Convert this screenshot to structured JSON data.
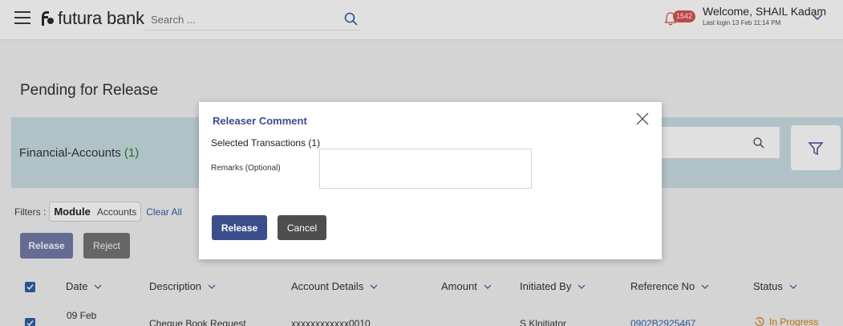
{
  "header": {
    "bank_name": "futura bank",
    "search_placeholder": "Search ...",
    "notification_count": "1542",
    "welcome": "Welcome, SHAIL Kadam",
    "last_login": "Last login 13 Feb 11:14 PM"
  },
  "page": {
    "title": "Pending for Release",
    "account_section_label": "Financial-Accounts",
    "account_section_count": "(1)"
  },
  "filters": {
    "label": "Filters :",
    "chip_key": "Module",
    "chip_value": "Accounts",
    "clear_all": "Clear All"
  },
  "actions": {
    "release": "Release",
    "reject": "Reject"
  },
  "table": {
    "columns": [
      "Date",
      "Description",
      "Account Details",
      "Amount",
      "Initiated By",
      "Reference No",
      "Status"
    ],
    "rows": [
      {
        "date": "09 Feb",
        "description": "Cheque Book Request",
        "account": "xxxxxxxxxxxx0010",
        "amount": "",
        "initiated_by": "S Klnitiator",
        "reference": "0902B2925467",
        "status": "In Progress"
      }
    ]
  },
  "modal": {
    "title": "Releaser Comment",
    "selected": "Selected Transactions (1)",
    "remarks_label": "Remarks (Optional)",
    "remarks_value": "",
    "release_label": "Release",
    "cancel_label": "Cancel"
  },
  "colors": {
    "brand_primary": "#3b4e8c",
    "account_bar": "#c9dde2",
    "status_in_progress": "#d47a14",
    "link": "#2f5fa7"
  }
}
